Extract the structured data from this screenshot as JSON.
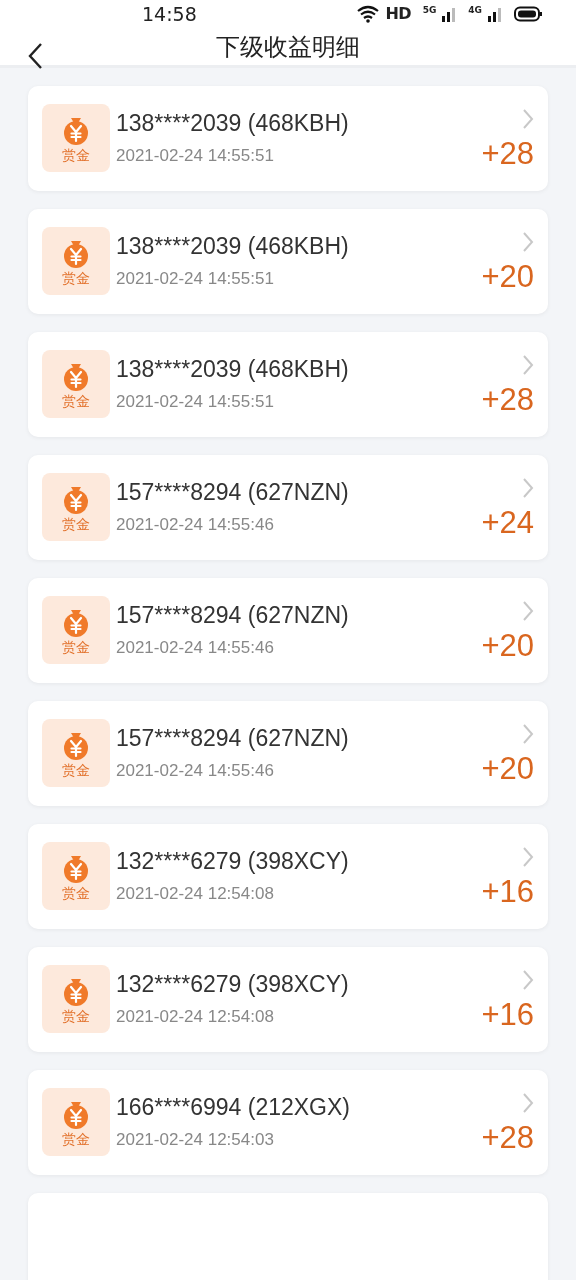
{
  "status_bar": {
    "time": "14:58",
    "hd": "HD",
    "net_1": "5G",
    "net_2": "4G"
  },
  "nav": {
    "title": "下级收益明细"
  },
  "records": [
    {
      "badge": "赏金",
      "user": "138****2039 (468KBH)",
      "time": "2021-02-24 14:55:51",
      "amount": "+28"
    },
    {
      "badge": "赏金",
      "user": "138****2039 (468KBH)",
      "time": "2021-02-24 14:55:51",
      "amount": "+20"
    },
    {
      "badge": "赏金",
      "user": "138****2039 (468KBH)",
      "time": "2021-02-24 14:55:51",
      "amount": "+28"
    },
    {
      "badge": "赏金",
      "user": "157****8294 (627NZN)",
      "time": "2021-02-24 14:55:46",
      "amount": "+24"
    },
    {
      "badge": "赏金",
      "user": "157****8294 (627NZN)",
      "time": "2021-02-24 14:55:46",
      "amount": "+20"
    },
    {
      "badge": "赏金",
      "user": "157****8294 (627NZN)",
      "time": "2021-02-24 14:55:46",
      "amount": "+20"
    },
    {
      "badge": "赏金",
      "user": "132****6279 (398XCY)",
      "time": "2021-02-24 12:54:08",
      "amount": "+16"
    },
    {
      "badge": "赏金",
      "user": "132****6279 (398XCY)",
      "time": "2021-02-24 12:54:08",
      "amount": "+16"
    },
    {
      "badge": "赏金",
      "user": "166****6994 (212XGX)",
      "time": "2021-02-24 12:54:03",
      "amount": "+28"
    }
  ]
}
